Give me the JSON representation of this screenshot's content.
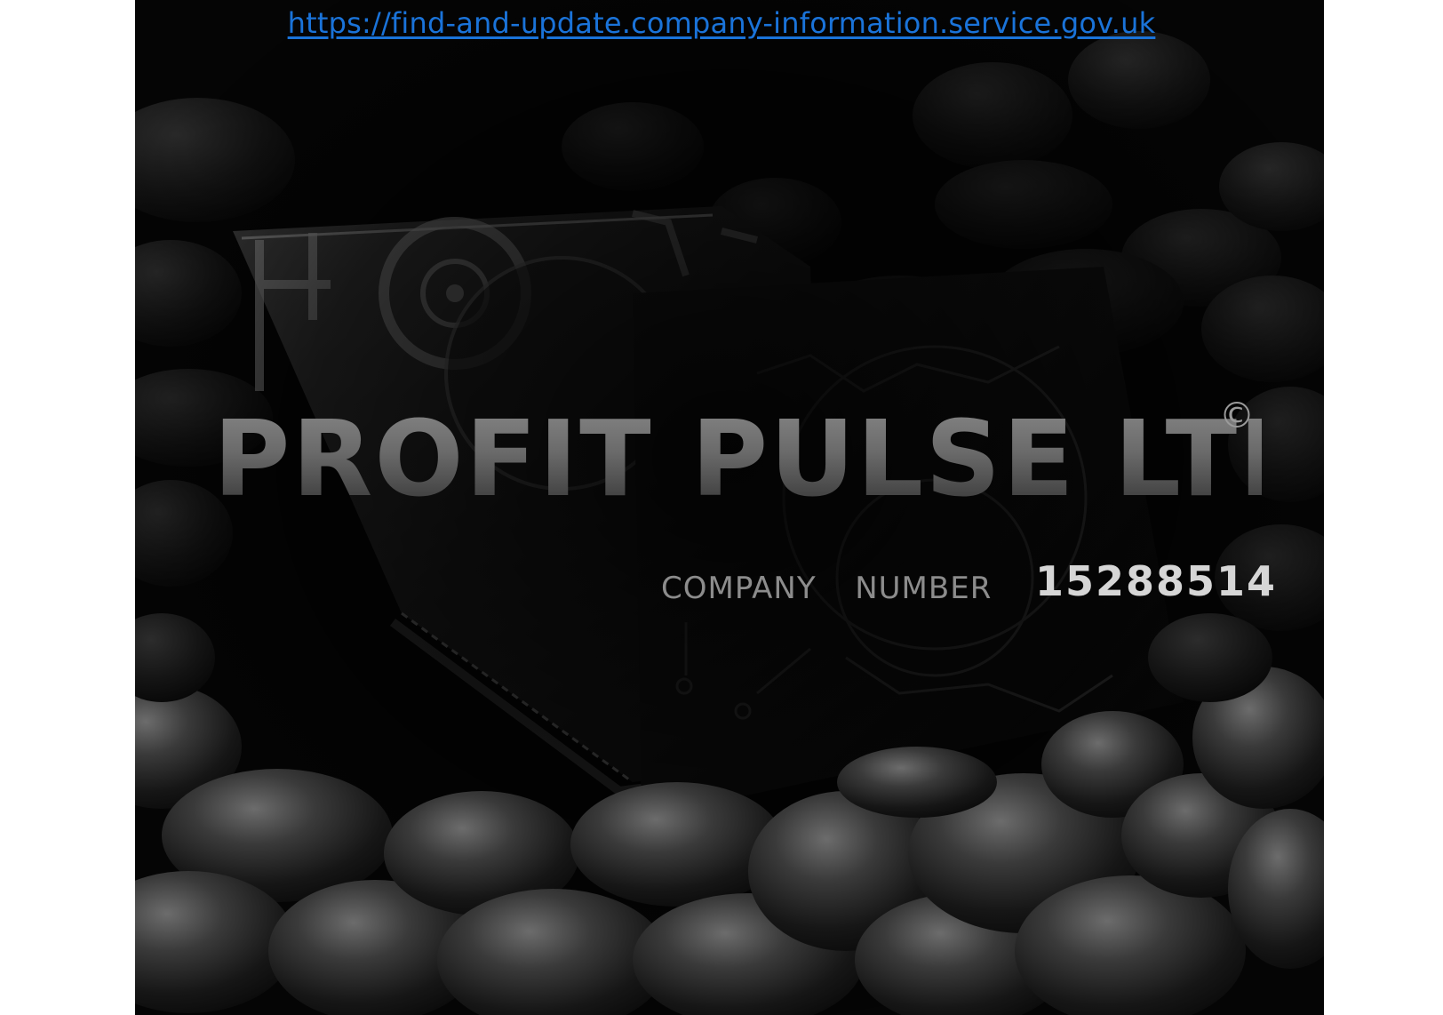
{
  "link": {
    "url_text": "https://find-and-update.company-information.service.gov.uk"
  },
  "poster": {
    "company_name": "PROFIT PULSE LTD",
    "copyright_symbol": "©",
    "number_label": "COMPANY  NUMBER",
    "company_number": "15288514"
  },
  "colors": {
    "link": "#1a73d9",
    "background": "#050505",
    "page": "#ffffff"
  },
  "icons": {
    "background_image": "black-stones-wallet-card-photo"
  }
}
